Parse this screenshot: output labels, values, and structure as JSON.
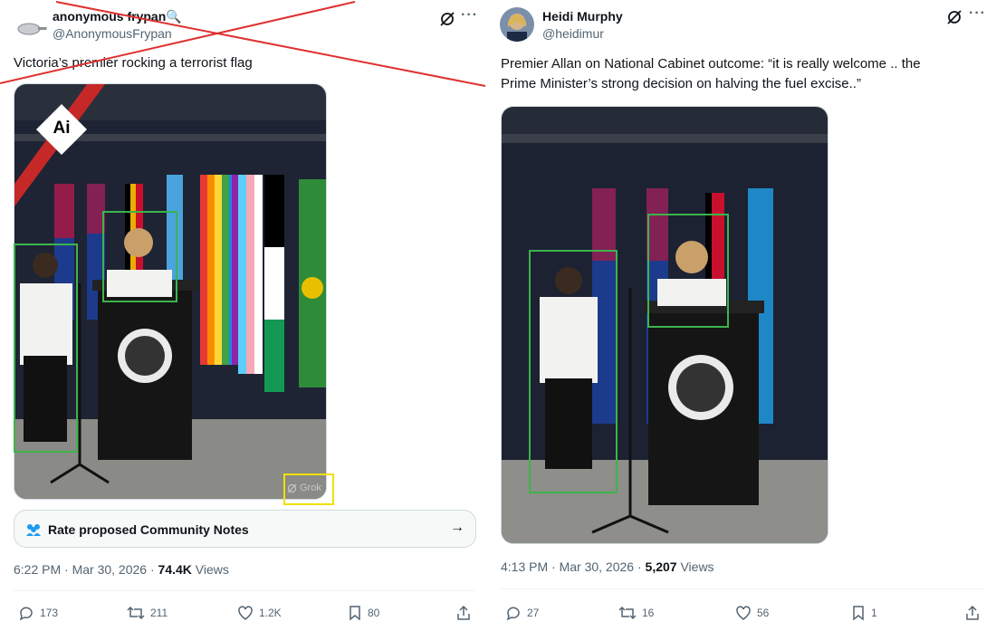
{
  "left_post": {
    "author_name": "anonymous frypan🔍",
    "handle": "@AnonymousFrypan",
    "text": "Victoria’s premier rocking a terrorist flag",
    "ai_badge": "Ai",
    "grok_watermark": "Grok",
    "community_notes_label": "Rate proposed Community Notes",
    "timestamp": "6:22 PM · Mar 30, 2026 · ",
    "views_count": "74.4K",
    "views_label": " Views",
    "actions": {
      "reply": "173",
      "repost": "211",
      "like": "1.2K",
      "bookmark": "80"
    }
  },
  "right_post": {
    "author_name": "Heidi Murphy",
    "handle": "@heidimur",
    "text_line1": "Premier Allan on National Cabinet outcome: “it is really welcome .. the",
    "text_line2": "Prime Minister’s strong decision on halving the fuel excise..”",
    "timestamp": "4:13 PM · Mar 30, 2026 · ",
    "views_count": "5,207",
    "views_label": " Views",
    "actions": {
      "reply": "27",
      "repost": "16",
      "like": "56",
      "bookmark": "1"
    }
  },
  "colors": {
    "annotation_green": "#3cb44b",
    "annotation_yellow": "#f2e000",
    "cross_red": "#e03030",
    "muted_text": "#536471"
  }
}
